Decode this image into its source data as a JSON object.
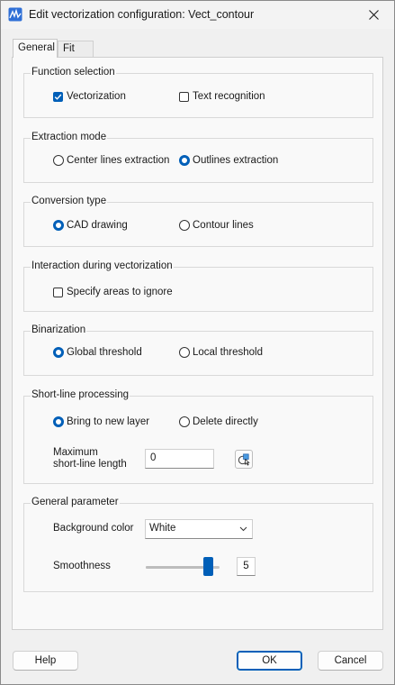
{
  "window": {
    "title": "Edit vectorization configuration: Vect_contour",
    "app_icon": "vectorization-app-icon",
    "close_icon": "close-icon"
  },
  "tabs": [
    {
      "label": "General",
      "selected": true
    },
    {
      "label": "Fit",
      "selected": false
    }
  ],
  "function_selection": {
    "title": "Function selection",
    "vectorization": {
      "label": "Vectorization",
      "checked": true
    },
    "text_recognition": {
      "label": "Text recognition",
      "checked": false
    }
  },
  "extraction_mode": {
    "title": "Extraction mode",
    "center_lines": {
      "label": "Center lines extraction",
      "selected": false
    },
    "outlines": {
      "label": "Outlines extraction",
      "selected": true
    }
  },
  "conversion_type": {
    "title": "Conversion type",
    "cad_drawing": {
      "label": "CAD drawing",
      "selected": true
    },
    "contour_lines": {
      "label": "Contour lines",
      "selected": false
    }
  },
  "interaction": {
    "title": "Interaction during vectorization",
    "specify_areas": {
      "label": "Specify areas to ignore",
      "checked": false
    }
  },
  "binarization": {
    "title": "Binarization",
    "global_threshold": {
      "label": "Global threshold",
      "selected": true
    },
    "local_threshold": {
      "label": "Local threshold",
      "selected": false
    }
  },
  "short_line": {
    "title": "Short-line processing",
    "bring_to_new_layer": {
      "label": "Bring to new layer",
      "selected": true
    },
    "delete_directly": {
      "label": "Delete directly",
      "selected": false
    },
    "max_length_label_line1": "Maximum",
    "max_length_label_line2": "short-line length",
    "max_length_value": "0",
    "pick_icon": "pick-length-icon"
  },
  "general_parameter": {
    "title": "General parameter",
    "background_color_label": "Background color",
    "background_color_value": "White",
    "smoothness_label": "Smoothness",
    "smoothness_value": "5",
    "smoothness_fraction": 0.9
  },
  "buttons": {
    "help": "Help",
    "ok": "OK",
    "cancel": "Cancel"
  },
  "colors": {
    "accent": "#005fb8",
    "background": "#f0f0f0"
  }
}
